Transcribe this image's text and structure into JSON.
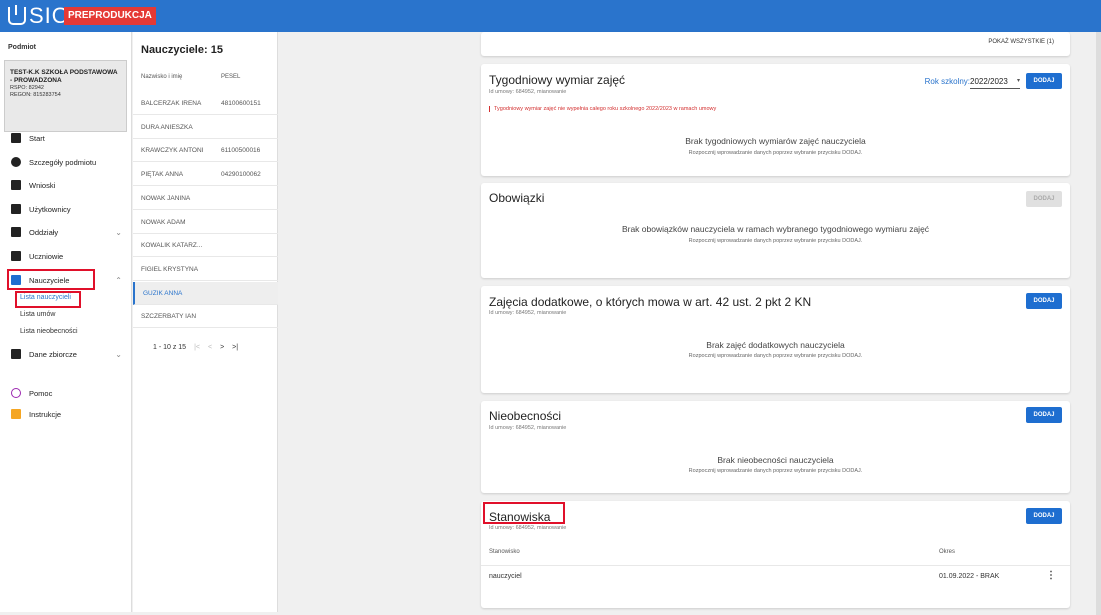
{
  "app": {
    "logo": "SIO",
    "env": "PREPRODUKCJA"
  },
  "sidebar": {
    "section_label": "Podmiot",
    "entity": {
      "name": "TEST-K.K SZKOŁA PODSTAWOWA - PROWADZONA",
      "rspo": "RSPO: 82942",
      "regon": "REGON: 815283754"
    },
    "items": [
      {
        "label": "Start",
        "icon": "grid-icon"
      },
      {
        "label": "Szczegóły podmiotu",
        "icon": "info-icon"
      },
      {
        "label": "Wnioski",
        "icon": "person-icon"
      },
      {
        "label": "Użytkownicy",
        "icon": "id-card-icon"
      },
      {
        "label": "Oddziały",
        "icon": "building-icon"
      },
      {
        "label": "Uczniowie",
        "icon": "graduation-cap-icon"
      },
      {
        "label": "Nauczyciele",
        "icon": "briefcase-icon"
      },
      {
        "label": "Dane zbiorcze",
        "icon": "folder-icon"
      },
      {
        "label": "Pomoc",
        "icon": "help-icon"
      },
      {
        "label": "Instrukcje",
        "icon": "document-icon"
      }
    ],
    "sub_items": [
      "Lista nauczycieli",
      "Lista umów",
      "Lista nieobecności"
    ]
  },
  "teachers": {
    "title": "Nauczyciele: 15",
    "col_name": "Nazwisko i imię",
    "col_pesel": "PESEL",
    "rows": [
      {
        "name": "BALCERZAK IRENA",
        "pesel": "48100600151"
      },
      {
        "name": "DURA ANIESZKA",
        "pesel": ""
      },
      {
        "name": "KRAWCZYK ANTONI",
        "pesel": "61100500016"
      },
      {
        "name": "PIĘTAK ANNA",
        "pesel": "04290100062"
      },
      {
        "name": "NOWAK JANINA",
        "pesel": ""
      },
      {
        "name": "NOWAK ADAM",
        "pesel": ""
      },
      {
        "name": "KOWALIK KATARZ...",
        "pesel": ""
      },
      {
        "name": "FIGIEL KRYSTYNA",
        "pesel": ""
      },
      {
        "name": "GUZIK ANNA",
        "pesel": ""
      },
      {
        "name": "SZCZERBATY IAN",
        "pesel": ""
      }
    ],
    "pager": {
      "range": "1 - 10 z 15",
      "first": "|<",
      "prev": "<",
      "next": ">",
      "last": ">|"
    }
  },
  "main": {
    "show_all": "POKAŻ WSZYSTKIE (1)",
    "weekly": {
      "title": "Tygodniowy wymiar zajęć",
      "sub": "Id umowy: 684952, mianowanie",
      "year_label": "Rok szkolny:",
      "year_value": "2022/2023",
      "add": "DODAJ",
      "warning": "Tygodniowy wymiar zajęć nie wypełnia całego roku szkolnego 2022/2023 w ramach umowy",
      "empty_title": "Brak tygodniowych wymiarów zajęć nauczyciela",
      "empty_sub": "Rozpocznij wprowadzanie danych poprzez wybranie przycisku DODAJ."
    },
    "duties": {
      "title": "Obowiązki",
      "add": "DODAJ",
      "empty_title": "Brak obowiązków nauczyciela w ramach wybranego tygodniowego wymiaru zajęć",
      "empty_sub": "Rozpocznij wprowadzanie danych poprzez wybranie przycisku DODAJ."
    },
    "extra": {
      "title": "Zajęcia dodatkowe, o których mowa w art. 42 ust. 2 pkt 2 KN",
      "sub": "Id umowy: 684952, mianowanie",
      "add": "DODAJ",
      "empty_title": "Brak zajęć dodatkowych nauczyciela",
      "empty_sub": "Rozpocznij wprowadzanie danych poprzez wybranie przycisku DODAJ."
    },
    "absence": {
      "title": "Nieobecności",
      "sub": "Id umowy: 684952, mianowanie",
      "add": "DODAJ",
      "empty_title": "Brak nieobecności nauczyciela",
      "empty_sub": "Rozpocznij wprowadzanie danych poprzez wybranie przycisku DODAJ."
    },
    "positions": {
      "title": "Stanowiska",
      "sub": "Id umowy: 684952, mianowanie",
      "add": "DODAJ",
      "col_position": "Stanowisko",
      "col_period": "Okres",
      "row": {
        "position": "nauczyciel",
        "period": "01.09.2022 - BRAK",
        "menu": "⋮"
      }
    }
  },
  "colors": {
    "primary": "#2a74cc",
    "button": "#1e6ed0",
    "highlight": "#e0102a",
    "badge": "#e53935"
  }
}
